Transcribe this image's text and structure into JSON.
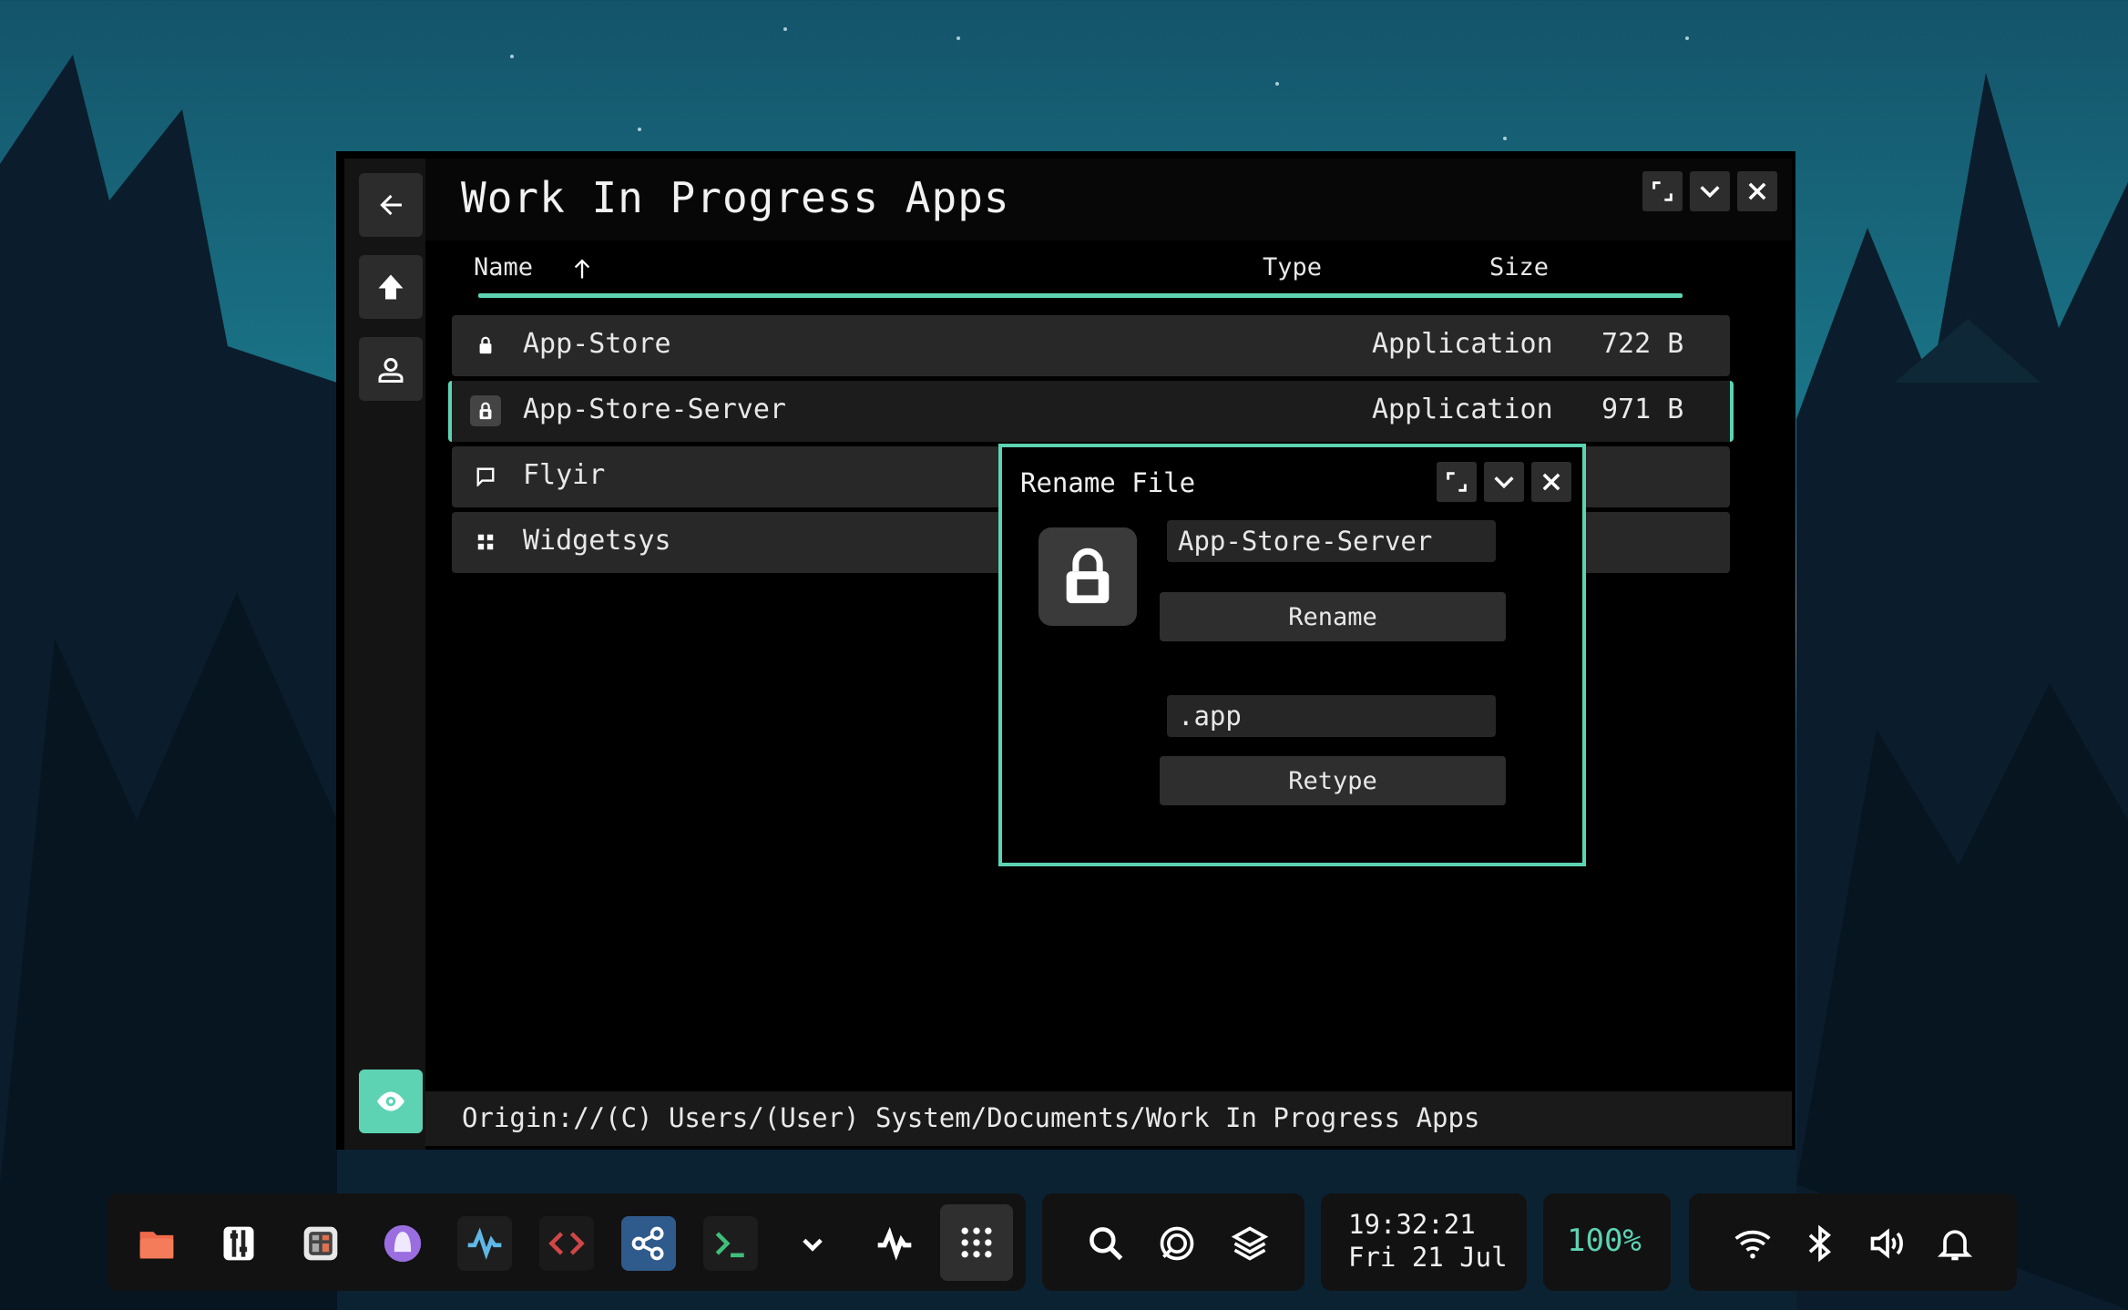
{
  "window": {
    "title": "Work In Progress Apps",
    "columns": {
      "name": "Name",
      "type": "Type",
      "size": "Size"
    },
    "rows": [
      {
        "name": "App-Store",
        "type": "Application",
        "size": "722 B",
        "icon": "lock-icon"
      },
      {
        "name": "App-Store-Server",
        "type": "Application",
        "size": "971 B",
        "icon": "lock-icon"
      },
      {
        "name": "Flyir",
        "type": "",
        "size": "",
        "icon": "message-icon"
      },
      {
        "name": "Widgetsys",
        "type": "",
        "size": "",
        "icon": "grid-icon"
      }
    ],
    "path": "Origin://(C) Users/(User) System/Documents/Work In Progress Apps"
  },
  "dialog": {
    "title": "Rename File",
    "name_value": "App-Store-Server",
    "rename_label": "Rename",
    "ext_value": ".app",
    "retype_label": "Retype"
  },
  "taskbar": {
    "time": "19:32:21",
    "date": "Fri 21 Jul",
    "battery": "100%"
  },
  "colors": {
    "accent": "#5dd3b3",
    "window_bg": "#000000",
    "row_bg": "#282828"
  }
}
